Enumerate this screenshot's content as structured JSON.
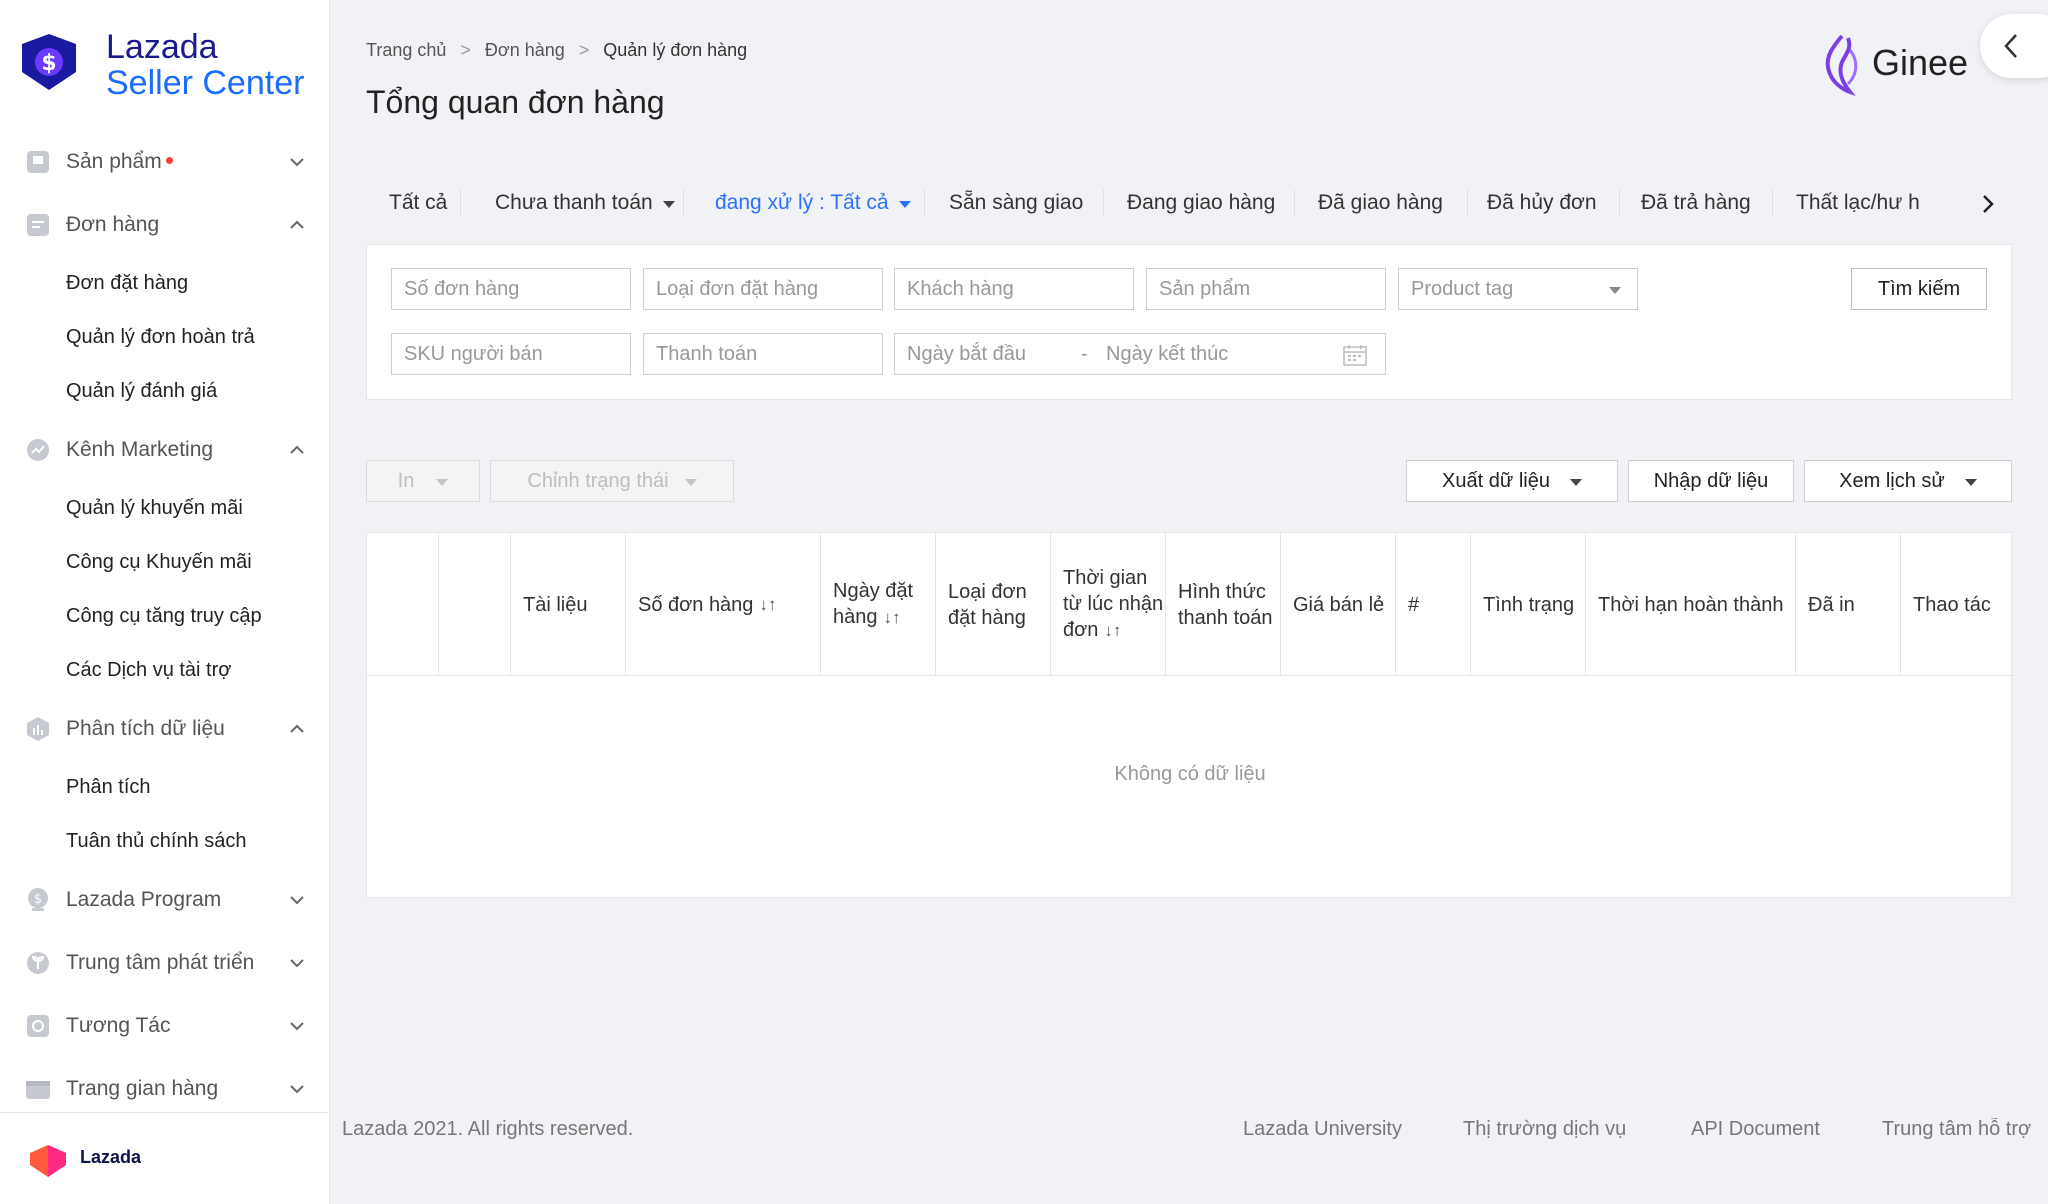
{
  "brand": {
    "line1": "Lazada",
    "line2": "Seller Center"
  },
  "sidebar": {
    "items": [
      {
        "label": "Sản phẩm",
        "icon": "product-icon",
        "expanded": false,
        "dot": true
      },
      {
        "label": "Đơn hàng",
        "icon": "order-icon",
        "expanded": true,
        "children": [
          "Đơn đặt hàng",
          "Quản lý đơn hoàn trả",
          "Quản lý đánh giá"
        ]
      },
      {
        "label": "Kênh Marketing",
        "icon": "marketing-icon",
        "expanded": true,
        "children": [
          "Quản lý khuyến mãi",
          "Công cụ Khuyến mãi",
          "Công cụ tăng truy cập",
          "Các Dịch vụ tài trợ"
        ]
      },
      {
        "label": "Phân tích dữ liệu",
        "icon": "analytics-icon",
        "expanded": true,
        "children": [
          "Phân tích",
          "Tuân thủ chính sách"
        ]
      },
      {
        "label": "Lazada Program",
        "icon": "program-icon",
        "expanded": false
      },
      {
        "label": "Trung tâm phát triển",
        "icon": "growth-icon",
        "expanded": false
      },
      {
        "label": "Tương Tác",
        "icon": "engage-icon",
        "expanded": false
      },
      {
        "label": "Trang gian hàng",
        "icon": "store-icon",
        "expanded": false
      }
    ],
    "footer_label": "Lazada"
  },
  "breadcrumb": [
    "Trang chủ",
    "Đơn hàng",
    "Quản lý đơn hàng"
  ],
  "page_title": "Tổng quan đơn hàng",
  "ginee_label": "Ginee",
  "tabs": [
    {
      "label": "Tất cả"
    },
    {
      "label": "Chưa thanh toán",
      "dropdown": true
    },
    {
      "label": "đang xử lý : Tất cả",
      "dropdown": true,
      "active": true
    },
    {
      "label": "Sẵn sàng giao"
    },
    {
      "label": "Đang giao hàng"
    },
    {
      "label": "Đã giao hàng"
    },
    {
      "label": "Đã hủy đơn"
    },
    {
      "label": "Đã trả hàng"
    },
    {
      "label": "Thất lạc/hư h"
    }
  ],
  "filters": {
    "order_no": "Số đơn hàng",
    "order_type": "Loại đơn đặt hàng",
    "customer": "Khách hàng",
    "product": "Sản phẩm",
    "product_tag": "Product tag",
    "seller_sku": "SKU người bán",
    "payment": "Thanh toán",
    "start_date": "Ngày bắt đầu",
    "date_separator": "-",
    "end_date": "Ngày kết thúc",
    "search_button": "Tìm kiếm"
  },
  "actions": {
    "print": "In",
    "change_status": "Chỉnh trạng thái",
    "export": "Xuất dữ liệu",
    "import": "Nhập dữ liệu",
    "history": "Xem lịch sử"
  },
  "table": {
    "columns": [
      {
        "label": ""
      },
      {
        "label": ""
      },
      {
        "label": "Tài liệu"
      },
      {
        "label": "Số đơn hàng",
        "sortable": true
      },
      {
        "label": "Ngày đặt hàng",
        "sortable": true
      },
      {
        "label": "Loại đơn đặt hàng"
      },
      {
        "label": "Thời gian từ lúc nhận đơn",
        "sortable": true
      },
      {
        "label": "Hình thức thanh toán"
      },
      {
        "label": "Giá bán lẻ"
      },
      {
        "label": "#"
      },
      {
        "label": "Tình trạng"
      },
      {
        "label": "Thời hạn hoàn thành"
      },
      {
        "label": "Đã in"
      },
      {
        "label": "Thao tác"
      }
    ],
    "sort_glyph": "↓↑",
    "empty_text": "Không có dữ liệu"
  },
  "footer": {
    "copyright": "Lazada 2021. All rights reserved.",
    "links": [
      "Lazada University",
      "Thị trường dịch vụ",
      "API Document",
      "Trung tâm hỗ trợ"
    ]
  },
  "colors": {
    "accent": "#2e6fff",
    "brand_dark": "#1a1a8c",
    "brand_blue": "#1a6bff",
    "ginee_purple": "#7b3fe4"
  }
}
